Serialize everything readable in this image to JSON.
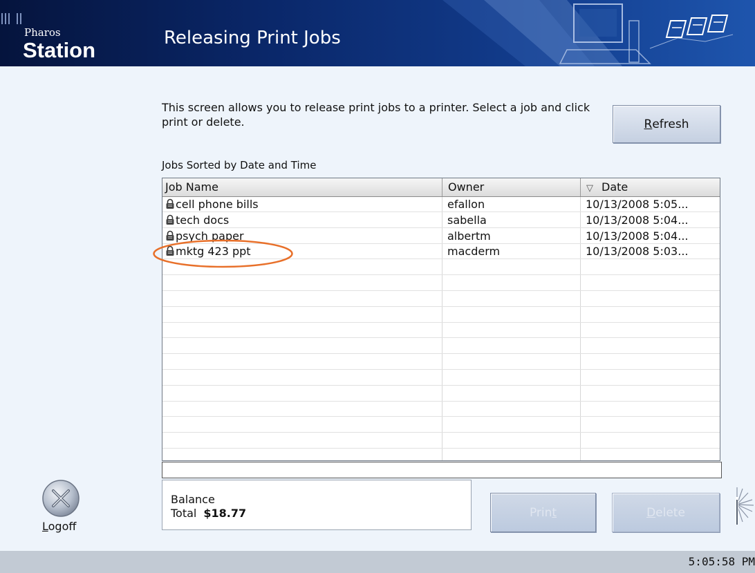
{
  "header": {
    "brand_small": "Pharos",
    "brand_big": "Station",
    "title": "Releasing Print Jobs"
  },
  "instructions": "This screen allows you to release print jobs to a printer. Select a job and click print or delete.",
  "refresh_button": {
    "prefix": "",
    "accel": "R",
    "rest": "efresh"
  },
  "jobs": {
    "sort_label": "Jobs Sorted by Date and Time",
    "columns": {
      "job_name": "Job Name",
      "owner": "Owner",
      "date": "Date"
    },
    "sort_arrow": "▽",
    "rows": [
      {
        "name": "cell phone bills",
        "owner": "efallon",
        "date": "10/13/2008 5:05..."
      },
      {
        "name": "tech docs",
        "owner": "sabella",
        "date": "10/13/2008 5:04..."
      },
      {
        "name": "psych paper",
        "owner": "albertm",
        "date": "10/13/2008 5:04..."
      },
      {
        "name": "mktg 423 ppt",
        "owner": "macderm",
        "date": "10/13/2008 5:03..."
      }
    ],
    "highlighted_row_index": 3
  },
  "balance": {
    "label": "Balance",
    "total_label": "Total",
    "total_amount": "$18.77"
  },
  "print_button": {
    "prefix": "Prin",
    "accel": "t",
    "rest": ""
  },
  "delete_button": {
    "prefix": "",
    "accel": "D",
    "rest": "elete"
  },
  "logoff": {
    "accel": "L",
    "rest": "ogoff",
    "icon": "logoff-x-icon"
  },
  "footer": {
    "time": "5:05:58 PM"
  },
  "colors": {
    "header_dark": "#05143d",
    "header_light": "#1e55ad",
    "background": "#eef4fb",
    "annotation": "#e8702a",
    "footer": "#c2cad4"
  }
}
